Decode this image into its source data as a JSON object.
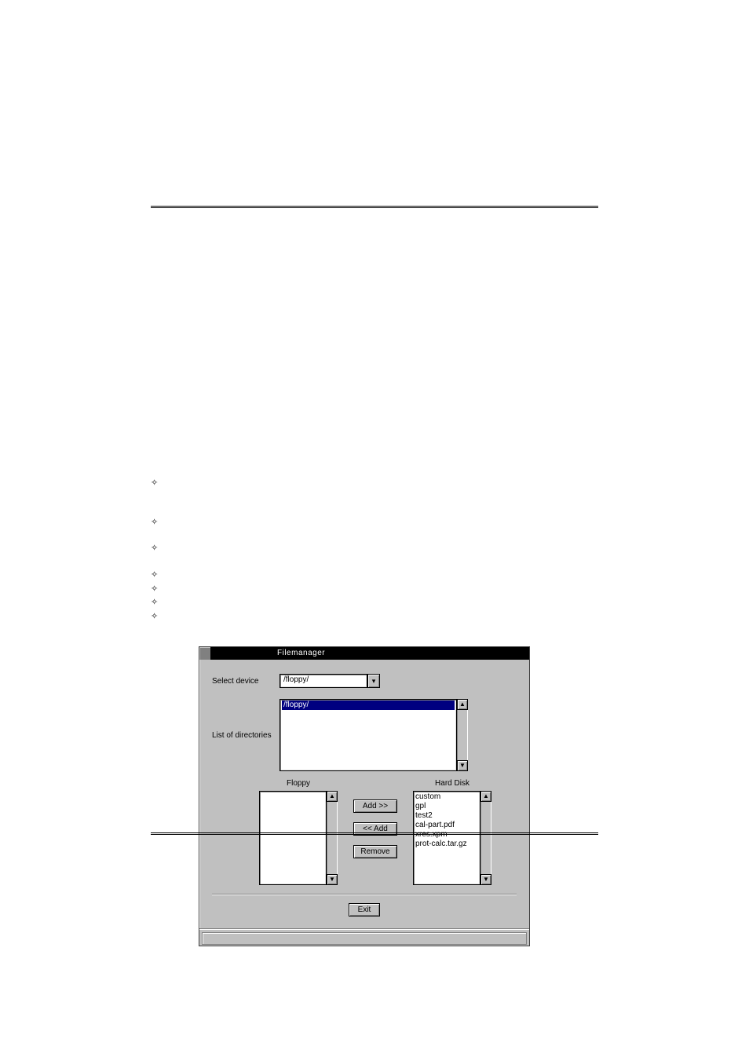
{
  "bullets": {
    "glyph": "✧"
  },
  "app": {
    "title": "Filemanager",
    "select_device_label": "Select device",
    "select_device_value": "/floppy/",
    "list_dir_label": "List of directories",
    "dir_highlight": "/floppy/",
    "floppy_heading": "Floppy",
    "harddisk_heading": "Hard Disk",
    "btn_add_to_hd": "Add >>",
    "btn_add_to_fd": "<< Add",
    "btn_remove": "Remove",
    "btn_exit": "Exit",
    "harddisk_items": [
      "custom",
      "gpl",
      "test2",
      "cal-part.pdf",
      "xres.xpm",
      "prot-calc.tar.gz"
    ],
    "floppy_items": [],
    "scroll_up": "▲",
    "scroll_down": "▼",
    "combo_arrow": "▾"
  }
}
